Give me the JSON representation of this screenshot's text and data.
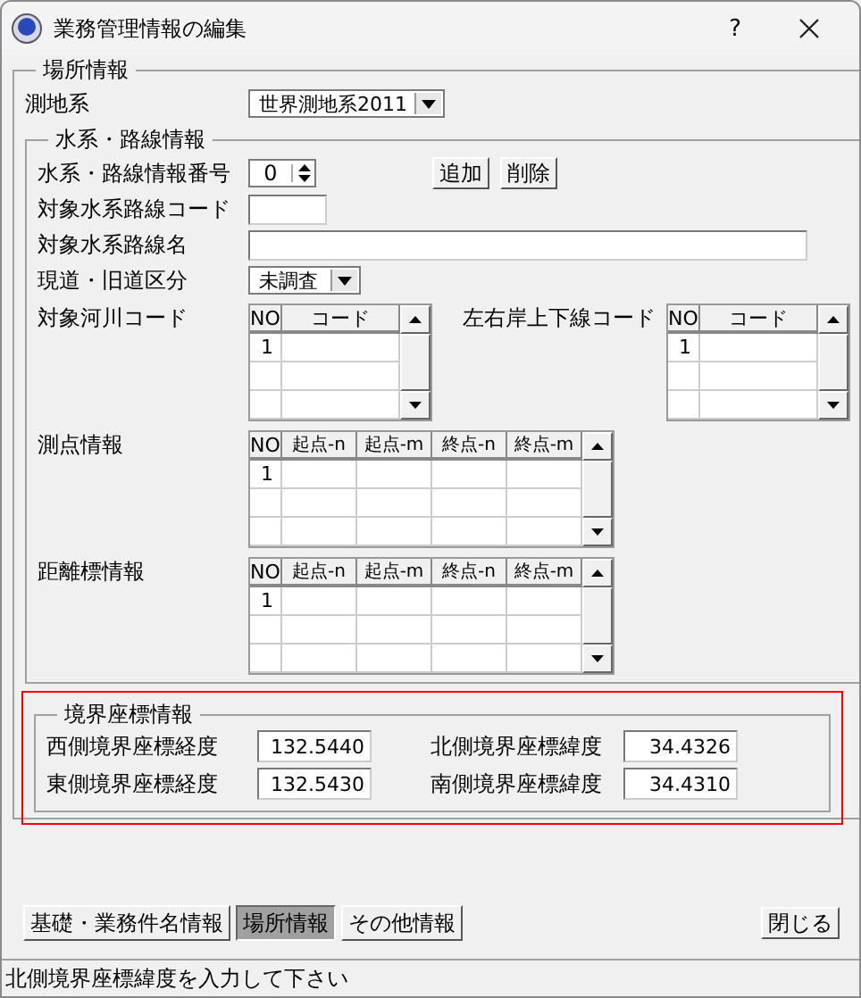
{
  "window": {
    "title": "業務管理情報の編集",
    "help": "?"
  },
  "location": {
    "legend": "場所情報",
    "datum": {
      "label": "測地系",
      "value": "世界測地系2011"
    },
    "route": {
      "legend": "水系・路線情報",
      "number": {
        "label": "水系・路線情報番号",
        "value": "0"
      },
      "add_button": "追加",
      "delete_button": "削除",
      "code": {
        "label": "対象水系路線コード"
      },
      "name": {
        "label": "対象水系路線名"
      },
      "road": {
        "label": "現道・旧道区分",
        "value": "未調査"
      },
      "code_grids": [
        {
          "label": "対象河川コード",
          "columns": [
            "NO",
            "コード"
          ],
          "rows": [
            [
              "1"
            ]
          ]
        },
        {
          "label": "左右岸上下線コード",
          "columns": [
            "NO",
            "コード"
          ],
          "rows": [
            [
              "1"
            ]
          ]
        }
      ],
      "wide_grids": [
        {
          "label": "測点情報",
          "columns": [
            "NO",
            "起点-n",
            "起点-m",
            "終点-n",
            "終点-m"
          ],
          "rows": [
            [
              "1"
            ]
          ]
        },
        {
          "label": "距離標情報",
          "columns": [
            "NO",
            "起点-n",
            "起点-m",
            "終点-n",
            "終点-m"
          ],
          "rows": [
            [
              "1"
            ]
          ]
        }
      ]
    },
    "boundary": {
      "legend": "境界座標情報",
      "fields": [
        {
          "label": "西側境界座標経度",
          "value": "132.5440"
        },
        {
          "label": "北側境界座標緯度",
          "value": "34.4326"
        },
        {
          "label": "東側境界座標経度",
          "value": "132.5430"
        },
        {
          "label": "南側境界座標緯度",
          "value": "34.4310"
        }
      ]
    }
  },
  "tabs": [
    {
      "label": "基礎・業務件名情報",
      "selected": false
    },
    {
      "label": "場所情報",
      "selected": true
    },
    {
      "label": "その他情報",
      "selected": false
    }
  ],
  "close_button": "閉じる",
  "status_bar": "北側境界座標緯度を入力して下さい"
}
